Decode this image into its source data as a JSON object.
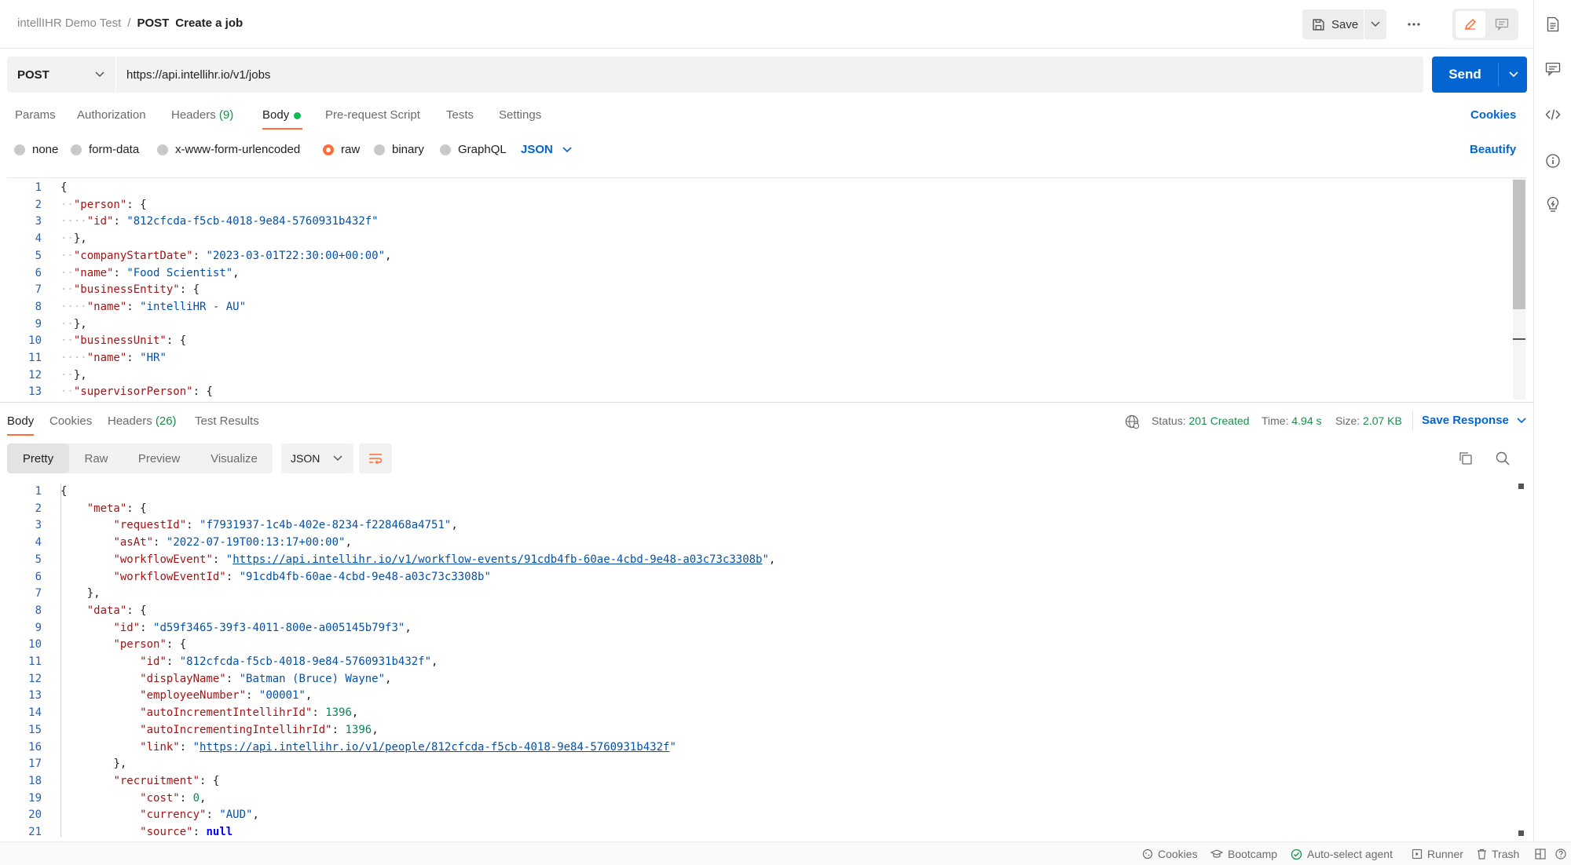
{
  "breadcrumb": {
    "workspace": "intellIHR Demo Test",
    "separator": "/",
    "method": "POST",
    "name": "Create a job"
  },
  "header": {
    "save_label": "Save"
  },
  "request": {
    "method": "POST",
    "url": "https://api.intellihr.io/v1/jobs",
    "send_label": "Send",
    "tabs": {
      "params": "Params",
      "authorization": "Authorization",
      "headers": "Headers",
      "headers_count": "(9)",
      "body": "Body",
      "prerequest": "Pre-request Script",
      "tests": "Tests",
      "settings": "Settings"
    },
    "cookies_label": "Cookies",
    "body_types": {
      "none": "none",
      "form_data": "form-data",
      "urlencoded": "x-www-form-urlencoded",
      "raw": "raw",
      "binary": "binary",
      "graphql": "GraphQL"
    },
    "raw_format": "JSON",
    "beautify_label": "Beautify",
    "body_lines": [
      "{",
      "  \"person\": {",
      "    \"id\": \"812cfcda-f5cb-4018-9e84-5760931b432f\"",
      "  },",
      "  \"companyStartDate\": \"2023-03-01T22:30:00+00:00\",",
      "  \"name\": \"Food Scientist\",",
      "  \"businessEntity\": {",
      "    \"name\": \"intelliHR - AU\"",
      "  },",
      "  \"businessUnit\": {",
      "    \"name\": \"HR\"",
      "  },",
      "  \"supervisorPerson\": {"
    ]
  },
  "response": {
    "tabs": {
      "body": "Body",
      "cookies": "Cookies",
      "headers": "Headers",
      "headers_count": "(26)",
      "test_results": "Test Results"
    },
    "status_label": "Status:",
    "status_value": "201 Created",
    "time_label": "Time:",
    "time_value": "4.94 s",
    "size_label": "Size:",
    "size_value": "2.07 KB",
    "save_response_label": "Save Response",
    "views": {
      "pretty": "Pretty",
      "raw": "Raw",
      "preview": "Preview",
      "visualize": "Visualize"
    },
    "format": "JSON",
    "body_lines": [
      "{",
      "    \"meta\": {",
      "        \"requestId\": \"f7931937-1c4b-402e-8234-f228468a4751\",",
      "        \"asAt\": \"2022-07-19T00:13:17+00:00\",",
      "        \"workflowEvent\": \"https://api.intellihr.io/v1/workflow-events/91cdb4fb-60ae-4cbd-9e48-a03c73c3308b\",",
      "        \"workflowEventId\": \"91cdb4fb-60ae-4cbd-9e48-a03c73c3308b\"",
      "    },",
      "    \"data\": {",
      "        \"id\": \"d59f3465-39f3-4011-800e-a005145b79f3\",",
      "        \"person\": {",
      "            \"id\": \"812cfcda-f5cb-4018-9e84-5760931b432f\",",
      "            \"displayName\": \"Batman (Bruce) Wayne\",",
      "            \"employeeNumber\": \"00001\",",
      "            \"autoIncrementIntellihrId\": 1396,",
      "            \"autoIncrementingIntellihrId\": 1396,",
      "            \"link\": \"https://api.intellihr.io/v1/people/812cfcda-f5cb-4018-9e84-5760931b432f\"",
      "        },",
      "        \"recruitment\": {",
      "            \"cost\": 0,",
      "            \"currency\": \"AUD\",",
      "            \"source\": null"
    ]
  },
  "footer": {
    "cookies": "Cookies",
    "bootcamp": "Bootcamp",
    "auto_select_agent": "Auto-select agent",
    "runner": "Runner",
    "trash": "Trash"
  },
  "icons": {
    "save": "save-icon",
    "caret": "chevron-down-icon",
    "more": "more-horizontal-icon",
    "edit": "pencil-icon",
    "comment": "comment-icon",
    "documentation": "document-icon",
    "comments": "comment-icon",
    "code": "code-icon",
    "info": "info-icon",
    "bulb": "lightbulb-icon",
    "globe": "globe-icon",
    "copy": "copy-icon",
    "search": "search-icon",
    "wrap": "wrap-lines-icon",
    "cookies": "cookie-icon",
    "bootcamp": "graduation-cap-icon",
    "agent": "check-circle-icon",
    "runner": "play-icon",
    "trash": "trash-icon",
    "layout": "layout-icon",
    "help": "help-icon"
  },
  "colors": {
    "accent": "#ff6c37",
    "send": "#0265d2",
    "success": "#1a8f4a",
    "link": "#0265d2"
  }
}
